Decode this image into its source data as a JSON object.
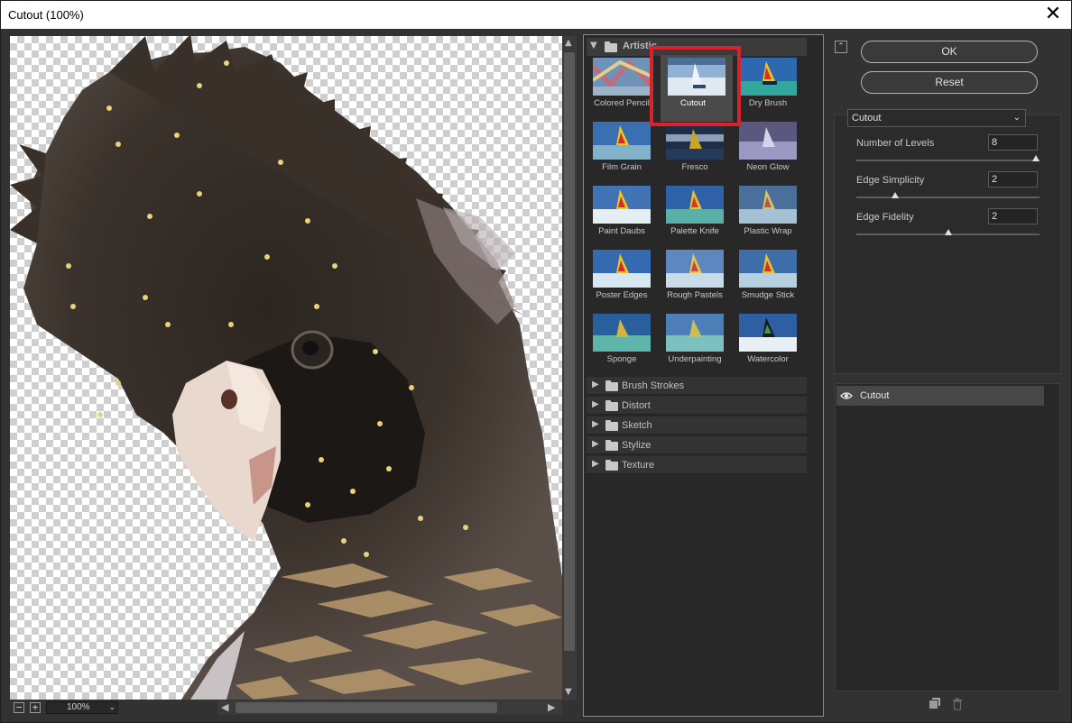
{
  "window": {
    "title": "Cutout (100%)",
    "close_glyph": "✕"
  },
  "preview": {
    "zoom": "100%",
    "zoom_out_glyph": "−",
    "zoom_in_glyph": "+"
  },
  "gallery": {
    "open_category": "Artistic",
    "filters": [
      {
        "label": "Colored Pencil",
        "selected": false
      },
      {
        "label": "Cutout",
        "selected": true
      },
      {
        "label": "Dry Brush",
        "selected": false
      },
      {
        "label": "Film Grain",
        "selected": false
      },
      {
        "label": "Fresco",
        "selected": false
      },
      {
        "label": "Neon Glow",
        "selected": false
      },
      {
        "label": "Paint Daubs",
        "selected": false
      },
      {
        "label": "Palette Knife",
        "selected": false
      },
      {
        "label": "Plastic Wrap",
        "selected": false
      },
      {
        "label": "Poster Edges",
        "selected": false
      },
      {
        "label": "Rough Pastels",
        "selected": false
      },
      {
        "label": "Smudge Stick",
        "selected": false
      },
      {
        "label": "Sponge",
        "selected": false
      },
      {
        "label": "Underpainting",
        "selected": false
      },
      {
        "label": "Watercolor",
        "selected": false
      }
    ],
    "collapsed_categories": [
      "Brush Strokes",
      "Distort",
      "Sketch",
      "Stylize",
      "Texture"
    ]
  },
  "buttons": {
    "ok": "OK",
    "reset": "Reset"
  },
  "settings": {
    "filter": "Cutout",
    "params": [
      {
        "label": "Number of Levels",
        "value": "8",
        "slider_fraction": 1.0
      },
      {
        "label": "Edge Simplicity",
        "value": "2",
        "slider_fraction": 0.2
      },
      {
        "label": "Edge Fidelity",
        "value": "2",
        "slider_fraction": 0.5
      }
    ]
  },
  "layers": [
    {
      "label": "Cutout",
      "visible": true
    }
  ],
  "colors": {
    "selection_outline": "#d9222a",
    "panel_bg": "#282828",
    "accent_text": "#e0e0e0"
  }
}
